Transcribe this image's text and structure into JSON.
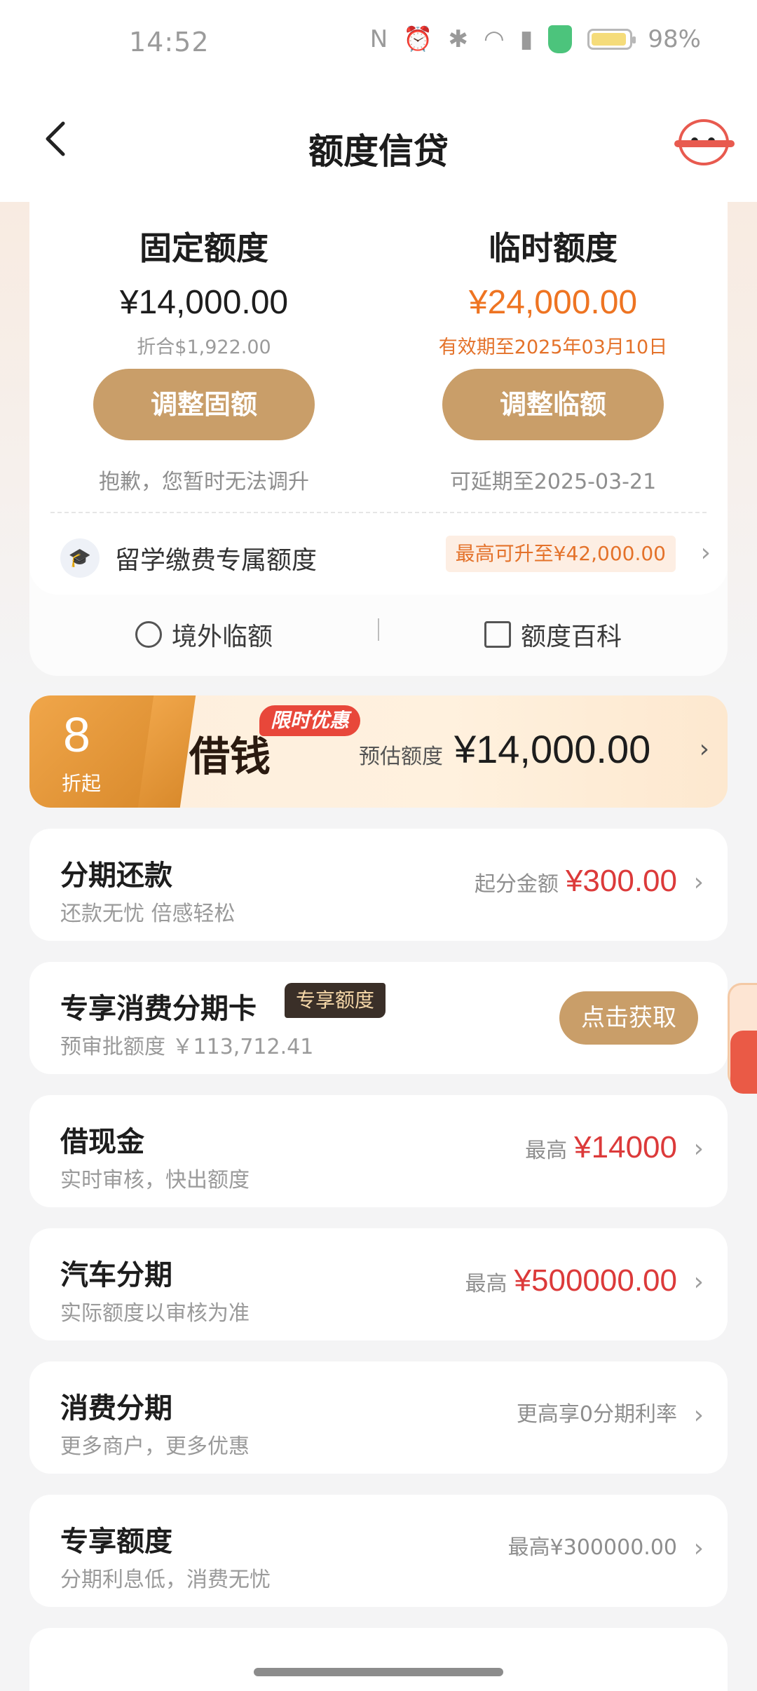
{
  "status_bar": {
    "time": "14:52",
    "battery": "98%"
  },
  "nav": {
    "title": "额度信贷"
  },
  "limits": {
    "fixed": {
      "title": "固定额度",
      "amount": "¥14,000.00",
      "sub": "折合$1,922.00",
      "button": "调整固额",
      "note": "抱歉，您暂时无法调升"
    },
    "temp": {
      "title": "临时额度",
      "amount": "¥24,000.00",
      "sub": "有效期至2025年03月10日",
      "button": "调整临额",
      "note": "可延期至2025-03-21"
    },
    "study": {
      "label": "留学缴费专属额度",
      "tag": "最高可升至¥42,000.00"
    },
    "tools": {
      "overseas": "境外临额",
      "wiki": "额度百科"
    }
  },
  "promo": {
    "discount": "8",
    "discount_unit": "折起",
    "title": "借钱",
    "badge": "限时优惠",
    "est_label": "预估额度",
    "est_amount": "¥14,000.00"
  },
  "rows": [
    {
      "title": "分期还款",
      "desc": "还款无忧 倍感轻松",
      "right_label": "起分金额",
      "right_value": "¥300.00"
    },
    {
      "title": "专享消费分期卡",
      "tag": "专享额度",
      "desc": "预审批额度 ￥113,712.41",
      "button": "点击获取"
    },
    {
      "title": "借现金",
      "desc": "实时审核，快出额度",
      "right_label": "最高",
      "right_value": "¥14000"
    },
    {
      "title": "汽车分期",
      "desc": "实际额度以审核为准",
      "right_label": "最高",
      "right_value": "¥500000.00"
    },
    {
      "title": "消费分期",
      "desc": "更多商户，更多优惠",
      "right_label": "更高享0分期利率"
    },
    {
      "title": "专享额度",
      "desc": "分期利息低，消费无忧",
      "right_label": "最高¥300000.00"
    }
  ],
  "colors": {
    "accent_gold": "#c99e69",
    "orange": "#ee7422",
    "red": "#dc3a3a"
  }
}
